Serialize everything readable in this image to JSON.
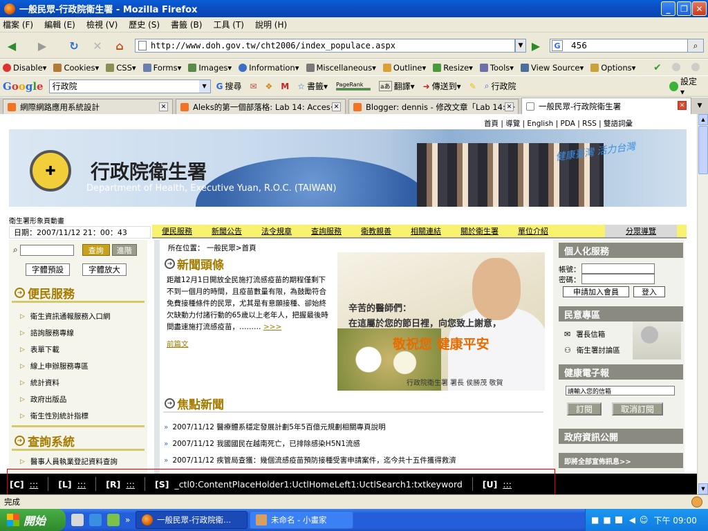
{
  "window": {
    "title": "一般民眾-行政院衛生署 - Mozilla Firefox"
  },
  "menu": [
    "檔案 (F)",
    "編輯 (E)",
    "檢視 (V)",
    "歷史 (S)",
    "書籤 (B)",
    "工具 (T)",
    "說明 (H)"
  ],
  "nav": {
    "url": "http://www.doh.gov.tw/cht2006/index_populace.aspx",
    "search_value": "456"
  },
  "devbar": [
    "Disable▾",
    "Cookies▾",
    "CSS▾",
    "Forms▾",
    "Images▾",
    "Information▾",
    "Miscellaneous▾",
    "Outline▾",
    "Resize▾",
    "Tools▾",
    "View Source▾",
    "Options▾"
  ],
  "gbar": {
    "logo": "Google",
    "query": "行政院",
    "search": "搜尋",
    "bookmarks": "書籤▾",
    "pagerank": "PageRank",
    "translate": "翻譯▾",
    "sendto": "傳送到▾",
    "highlight": "行政院",
    "settings": "設定▾"
  },
  "tabs": [
    {
      "label": "網際網路應用系統設計"
    },
    {
      "label": "Aleks的第一個部落格: Lab 14: Acces···"
    },
    {
      "label": "Blogger: dennis - 修改文章「Lab 14: ···"
    },
    {
      "label": "一般民眾-行政院衛生署"
    }
  ],
  "site": {
    "toplinks": "首頁 | 導覽 | English | PDA | RSS | 雙語詞彙",
    "org_name": "行政院衛生署",
    "org_en": "Department of Health, Executive Yuan, R.O.C. (TAIWAN)",
    "slogan": "健康臺灣 活力台灣",
    "subline": "衛生署形象頁動畫",
    "date": "日期：2007/11/12  21：00：43",
    "topnav": [
      "便民服務",
      "新聞公告",
      "法令規章",
      "查詢服務",
      "衛教親善",
      "相關連結",
      "關於衛生署",
      "單位介紹"
    ],
    "share": "分眾導覽"
  },
  "left": {
    "search_btn": "查詢",
    "advanced_btn": "進階",
    "font_default": "字體預設",
    "font_large": "字體放大",
    "section1": "便民服務",
    "items1": [
      "衛生資訊通報服務入口網",
      "諮詢服務專線",
      "表單下載",
      "線上申辦服務專區",
      "統計資料",
      "政府出版品",
      "衛生性別統計指標"
    ],
    "section2": "查詢系統",
    "items2": [
      "醫事人員執業登記資料查詢"
    ]
  },
  "center": {
    "crumb": "所在位置： 一般民眾>首頁",
    "news_title": "新聞頭條",
    "news_text": "距離12月1日開放全民施打流感疫苗的期程僅剩下不到一個月的時間，且疫苗數量有限，為鼓勵符合免費接種條件的民眾，尤其是有意願接種、卻始終欠缺動力付諸行動的65歲以上老年人，把握最後時間盡速施打流感疫苗，………",
    "news_more": ">>>",
    "news_prev": "前篇文",
    "img_line1": "辛苦的醫師們：",
    "img_line2": "在這屬於您的節日裡，向您致上謝意，",
    "img_line3": "敬祝您 健康平安",
    "img_line4": "行政院衛生署 署長 侯勝茂 敬賀",
    "focus_title": "焦點新聞",
    "focus_items": [
      "2007/11/12 醫療體系穩定發展計劃5年5百億元規劃相關專頁說明",
      "2007/11/12 我國國民在越南死亡，已排除感染H5N1流感",
      "2007/11/12 疾管局查獲：幾個流感疫苗預防接種受害申請案件，迄今共十五件獲得救濟"
    ]
  },
  "right": {
    "personal_title": "個人化服務",
    "account_label": "帳號：",
    "password_label": "密碼：",
    "join_btn": "申請加入會員",
    "login_btn": "登入",
    "opinion_title": "民意專區",
    "mailbox": "署長信箱",
    "forum": "衛生署討論區",
    "epaper_title": "健康電子報",
    "epaper_placeholder": "請輸入您的信箱",
    "subscribe_btn": "訂閱",
    "unsubscribe_btn": "取消訂閱",
    "gov_title": "政府資訊公開",
    "promo": "即將全部宣佈訊息>>"
  },
  "overlay": [
    {
      "key": "[C]",
      "val": ":::"
    },
    {
      "key": "[L]",
      "val": ":::"
    },
    {
      "key": "[R]",
      "val": ":::"
    },
    {
      "key": "[S]",
      "val": "_ctl0:ContentPlaceHolder1:UctlHomeLeft1:UctlSearch1:txtkeyword"
    },
    {
      "key": "[U]",
      "val": ":::"
    }
  ],
  "status": "完成",
  "taskbar": {
    "start": "開始",
    "task1": "一般民眾-行政院衛...",
    "task2": "未命名 - 小畫家",
    "clock": "下午 09:00"
  }
}
